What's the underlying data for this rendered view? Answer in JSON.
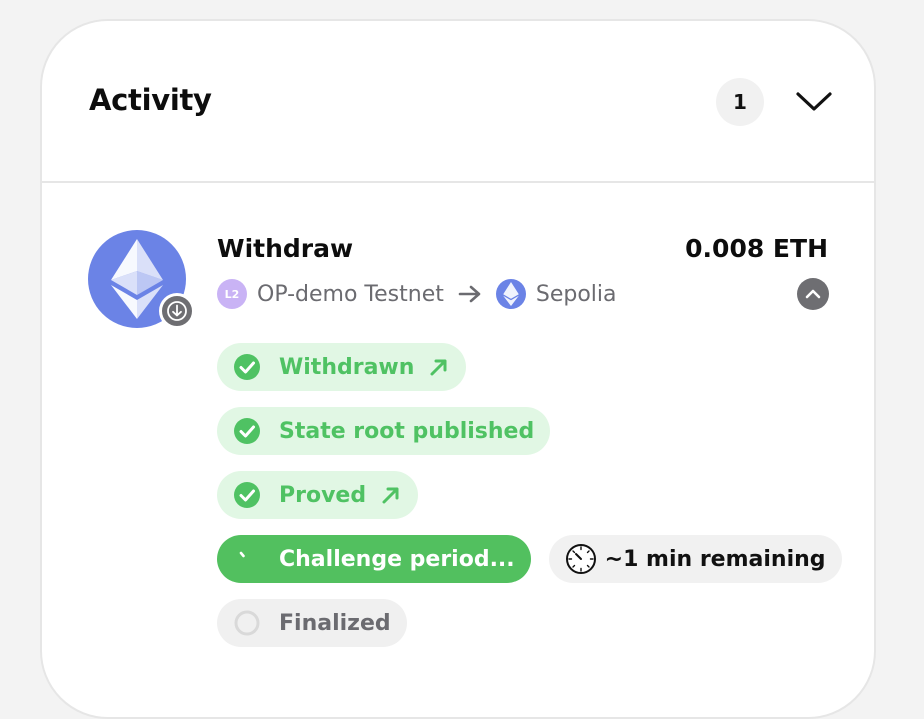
{
  "panel": {
    "title": "Activity",
    "count": "1",
    "collapse_icon": "chevron-down-icon"
  },
  "transaction": {
    "type": "Withdraw",
    "amount": "0.008 ETH",
    "asset_icon": "ethereum-icon",
    "direction_icon": "arrow-down-icon",
    "from_chain": {
      "name": "OP-demo Testnet",
      "icon_text": "L2",
      "icon": "l2-chain-icon"
    },
    "to_chain": {
      "name": "Sepolia",
      "icon": "ethereum-icon"
    },
    "expand_icon": "chevron-up-icon"
  },
  "steps": [
    {
      "label": "Withdrawn",
      "status": "complete",
      "has_link": true
    },
    {
      "label": "State root published",
      "status": "complete",
      "has_link": false
    },
    {
      "label": "Proved",
      "status": "complete",
      "has_link": true
    },
    {
      "label": "Challenge period...",
      "status": "in-progress",
      "has_link": false,
      "time_remaining": "~1 min remaining"
    },
    {
      "label": "Finalized",
      "status": "pending",
      "has_link": false
    }
  ],
  "colors": {
    "success": "#4fc263",
    "success_bg": "#e1f7e4",
    "active": "#52c05f",
    "eth": "#6b83e6",
    "l2": "#c9b3f5"
  }
}
